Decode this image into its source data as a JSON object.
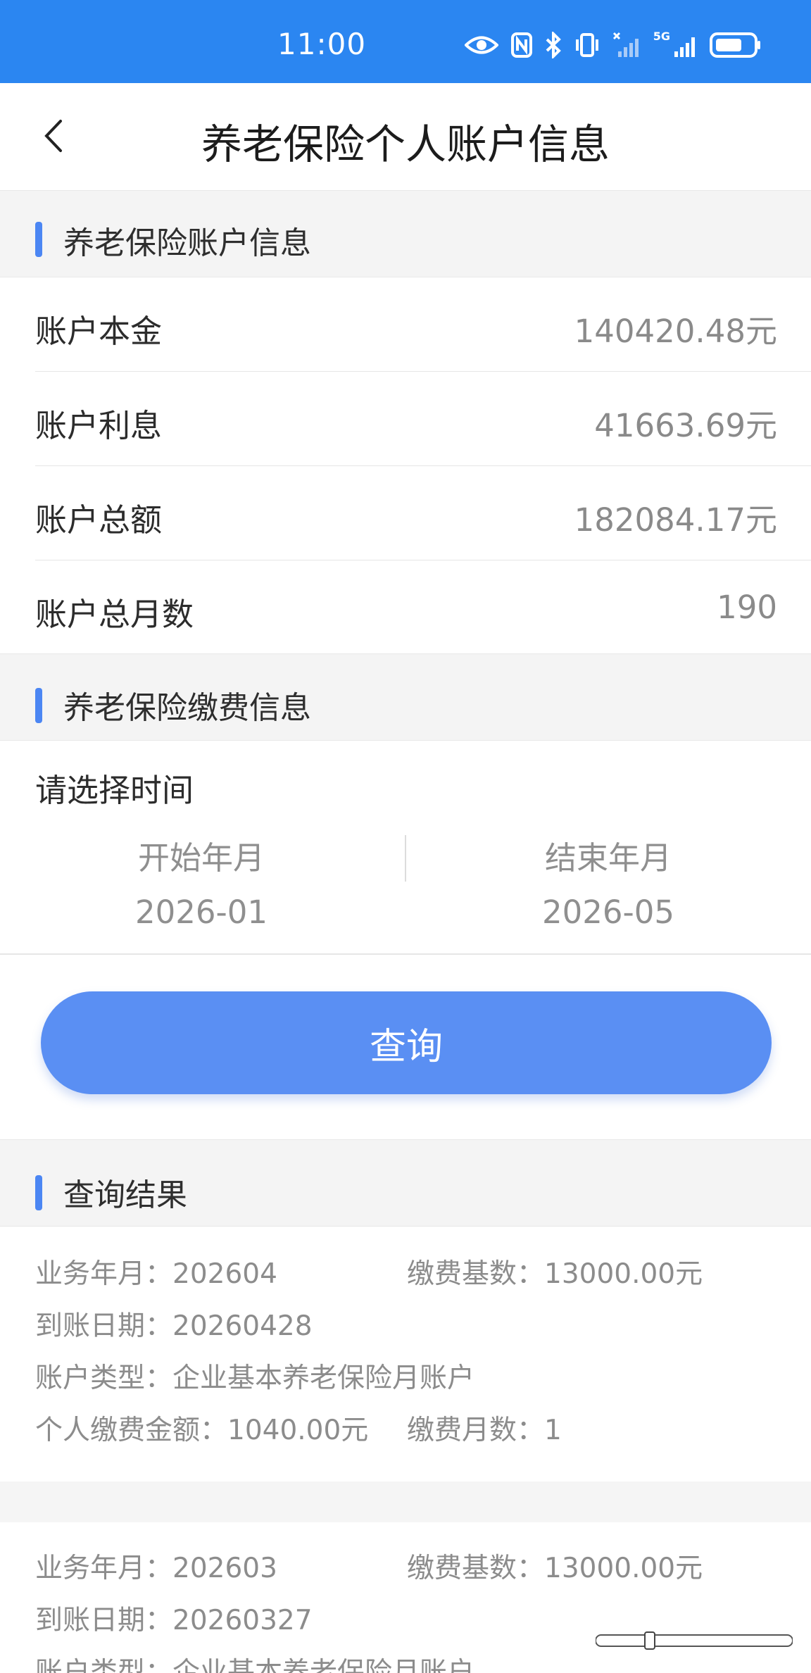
{
  "status_bar": {
    "time": "11:00",
    "network_label": "5G"
  },
  "header": {
    "title": "养老保险个人账户信息"
  },
  "account_section": {
    "title": "养老保险账户信息",
    "rows": [
      {
        "label": "账户本金",
        "value": "140420.48元"
      },
      {
        "label": "账户利息",
        "value": "41663.69元"
      },
      {
        "label": "账户总额",
        "value": "182084.17元"
      },
      {
        "label": "账户总月数",
        "value": "190"
      }
    ]
  },
  "payment_section": {
    "title": "养老保险缴费信息",
    "select_label": "请选择时间",
    "start": {
      "label": "开始年月",
      "value": "2026-01"
    },
    "end": {
      "label": "结束年月",
      "value": "2026-05"
    }
  },
  "query_button": "查询",
  "result_section": {
    "title": "查询结果",
    "records": [
      {
        "biz_month": "业务年月：202604",
        "base": "缴费基数：13000.00元",
        "arrival": "到账日期：20260428",
        "acct_type": "账户类型：企业基本养老保险月账户",
        "amount": "个人缴费金额：1040.00元",
        "months": "缴费月数：1"
      },
      {
        "biz_month": "业务年月：202603",
        "base": "缴费基数：13000.00元",
        "arrival": "到账日期：20260327",
        "acct_type": "账户类型：企业基本养老保险月账户"
      }
    ]
  },
  "colors": {
    "status_bar": "#2b86f1",
    "accent": "#4b86f3",
    "button": "#5a8ff3"
  }
}
